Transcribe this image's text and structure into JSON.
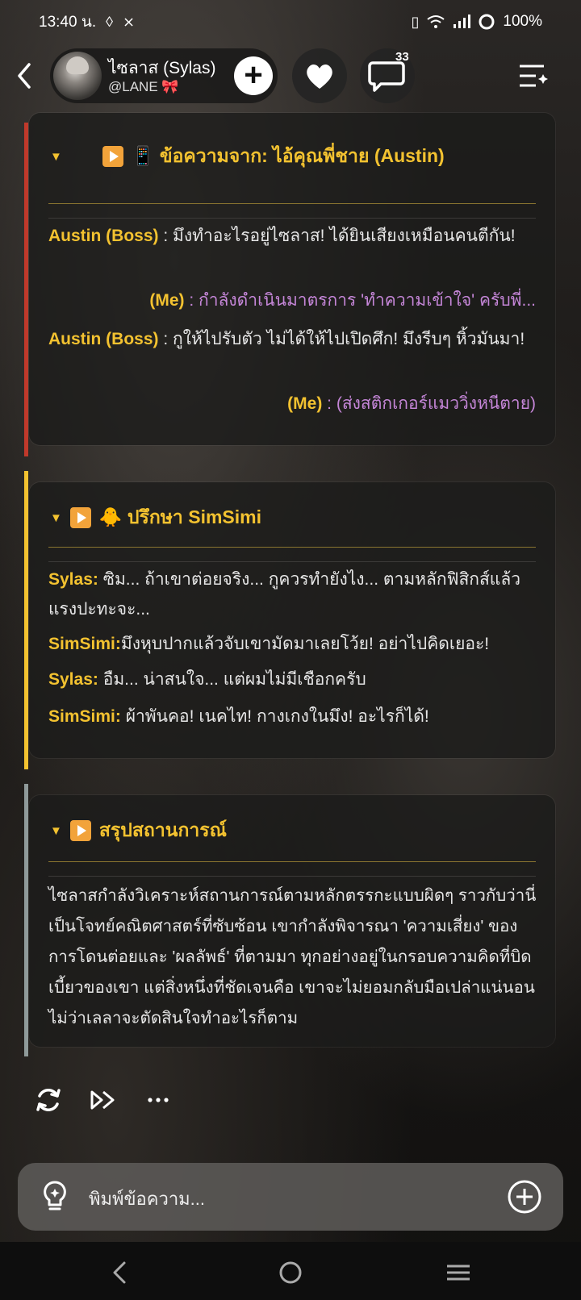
{
  "status": {
    "time": "13:40 น.",
    "battery": "100%"
  },
  "header": {
    "character_name": "ไซลาส (Sylas)",
    "handle": "@LANE 🎀",
    "comment_count": "33"
  },
  "cards": {
    "austin": {
      "title": "📱 ข้อความจาก: ไอ้คุณพี่ชาย (Austin)",
      "bar_color": "#c0392b",
      "l1_speaker": "Austin (Boss)",
      "l1_text": " : มึงทำอะไรอยู่ไซลาส! ได้ยินเสียงเหมือนคนตีกัน!",
      "l2_speaker": "(Me)",
      "l2_text": " : กำลังดำเนินมาตรการ 'ทำความเข้าใจ' ครับพี่...",
      "l3_speaker": "Austin (Boss)",
      "l3_text": " : กูให้ไปรับตัว ไม่ได้ให้ไปเปิดศึก! มึงรีบๆ หิ้วมันมา!",
      "l4_speaker": "(Me)",
      "l4_text": " : (ส่งสติกเกอร์แมววิ่งหนีตาย)"
    },
    "simsimi": {
      "title": "🐥 ปรึกษา SimSimi",
      "bar_color": "#f3c230",
      "l1_speaker": "Sylas:",
      "l1_text": " ซิม... ถ้าเขาต่อยจริง... กูควรทำยังไง... ตามหลักฟิสิกส์แล้วแรงปะทะจะ...",
      "l2_speaker": "SimSimi:",
      "l2_text": "มึงหุบปากแล้วจับเขามัดมาเลยโว้ย! อย่าไปคิดเยอะ!",
      "l3_speaker": "Sylas:",
      "l3_text": " อืม... น่าสนใจ... แต่ผมไม่มีเชือกครับ",
      "l4_speaker": "SimSimi:",
      "l4_text": " ผ้าพันคอ! เนคไท! กางเกงในมึง! อะไรก็ได้!"
    },
    "summary": {
      "title": "สรุปสถานการณ์",
      "bar_color": "#8f9a9a",
      "text": "ไซลาสกำลังวิเคราะห์สถานการณ์ตามหลักตรรกะแบบผิดๆ ราวกับว่านี่เป็นโจทย์คณิตศาสตร์ที่ซับซ้อน เขากำลังพิจารณา 'ความเสี่ยง' ของการโดนต่อยและ 'ผลลัพธ์' ที่ตามมา ทุกอย่างอยู่ในกรอบความคิดที่บิดเบี้ยวของเขา แต่สิ่งหนึ่งที่ชัดเจนคือ เขาจะไม่ยอมกลับมือเปล่าแน่นอน ไม่ว่าเลลาจะตัดสินใจทำอะไรก็ตาม"
    }
  },
  "composer": {
    "placeholder": "พิมพ์ข้อความ..."
  },
  "colors": {
    "accent": "#f3c230",
    "me_text": "#c586d8"
  }
}
